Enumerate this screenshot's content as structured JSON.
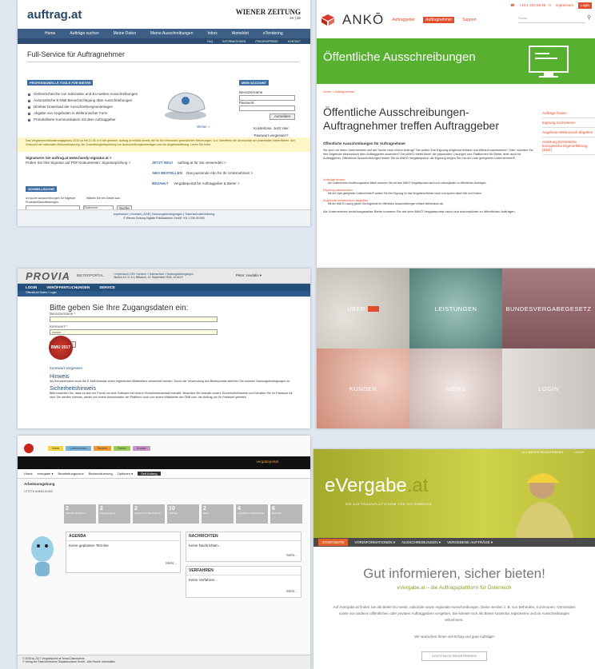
{
  "p1": {
    "logo": "auftrag.at",
    "brand": "WIENER ZEITUNG",
    "lang": "en | de",
    "nav": [
      "Home",
      "Aufträge suchen",
      "Meine Daten",
      "Meine Ausschreibungen",
      "Inbox",
      "Abmeldet",
      "eTendering"
    ],
    "subnav": [
      "FAQ",
      "INFORMATIONEN",
      "FRAGEN/PREISE",
      "KONTAKT"
    ],
    "title": "Full-Service für Auftragnehmer",
    "tools_heading": "PROFESSIONELLE TOOLS FÜR BIETER",
    "bullets": [
      "Onlinerecherche von nationalen und EU-weiten Ausschreibungen",
      "Automatische E-Mail Benachrichtigung über Ausschreibungen",
      "Direkter Download der Ausschreibungsunterlagen",
      "Abgabe von Angeboten in elektronischer Form",
      "Protokollierte Kommunikation mit dem Auftraggeber"
    ],
    "weiter": "Weiter »",
    "account_heading": "MEIN ACCOUNT",
    "username_label": "Benutzername",
    "password_label": "Passwort",
    "login_button": "Anmelden",
    "register_link": "Kostenlose. Jetzt Hier",
    "forgot_link": "Passwort vergessen?",
    "notice": "Das Vergaberechtsänderungsgesetz 2015 ist mit 21.08. in Kraft getreten. auftrag.at enthält bereits die für Sie relevanten gesetzlichen Neuerungen. U.a. betreffend die Anonymität der potentiellen Bieter/Bieter, den Zeitpunkt der nationalen Bekanntmachung, die Zuverlässigkeitsprüfung von Ausschreibungsunterlagen und die Angebotsöffnung. Lesen Sie mehr",
    "signaturen": "Signaturen Sie auftrag.at www.handy-signatur.at >",
    "signaturen_sub": "Prüfen Sie Ihre Signatur auf PDF-Dokumenten: Signaturprüfung >",
    "jetzt_neu": "JETZT NEU!",
    "jetzt_neu_text": "auftrag.at für Sie verwenden >",
    "abo": "ABO BESTELLEN",
    "abo_text": "Das passende Abo für Ihr Unternehmen >",
    "bezahlt": "BEZAHLT",
    "bezahlt_text": "Vergabeportal für Auftraggeber & Bieter >",
    "quick_heading": "SCHNELLSUCHE",
    "quick_label": "Ich suche Ausschreibungen für folgende Produkte/Dienstleistungen:",
    "quick_label2": "Wählen Sie ein Gebiet aus:",
    "region_value": "Österreich",
    "search_button": "Suche",
    "footer_links": "Impressum | Kontakt | AGB | Nutzungsbedingungen | Datenschutzerklärung",
    "footer_copy": "© Wiener Zeitung Digitale Publikationen GmbH +43 1 206 99-500"
  },
  "p2": {
    "phone": "+43 1 333 66 66 - 0",
    "impressum": "Impressum",
    "login": "Login",
    "logo": "ANKŌ",
    "nav": [
      "Auftraggeber",
      "Auftragnehmer",
      "Support"
    ],
    "search_placeholder": "Suche",
    "banner": "Öffentliche Ausschreibungen",
    "breadcrumb": "Home > Auftragnehmer",
    "h1": "Öffentliche Ausschreibungen-Auftragnehmer treffen Auftraggeber",
    "sub": "Öffentliche Ausschreibungen für Auftragnehmer",
    "para": "Sie sind mit Ihrem Unternehmen auf der Suche nach einem Auftrag? Sie wollen Ihre Eignung möglichst einfach und effizient nachweisen? Oder möchten Sie Ihre Angebote elektronisch dem Auftraggeber zusenden? Der ANKÖ bietet Ihnen die passenden Lösungen und Plattformen für Bieter, aber auch für Auftraggeber. Öffentliche Ausschreibungen finden Sie im ANKÖ Vergabeportal, die Eignung zeigen Sie mit der Liste geeigneter Unternehmen®.",
    "items": [
      {
        "title": "Aufträge finden",
        "text": "Als Unternehmen beziehungsweise Bieter kommen Sie mit dem ANKÖ Vergabeportal rasch und unkompliziert zu öffentlichen Aufträgen."
      },
      {
        "title": "Eignung nachweisen",
        "text": "Mit der Liste geeigneter Unternehmen® weisen Sie Ihre Eignung für das Vergabeverfahren rasch und sparen dabei Zeit und Kosten."
      },
      {
        "title": "Angebote elektronisch abgeben",
        "text": "Mit der ANKÖ Lösung geben Sie Angebote für öffentliche Ausschreibungen einfach elektronisch ab."
      }
    ],
    "closing": "Als Unternehmen beziehungsweise Bieter kommen Sie mit dem ANKÖ Vergabeportal rasch und unkompliziert zu öffentlichen Aufträgen.",
    "side": [
      "Aufträge finden",
      "Eignung nachweisen",
      "Angebote elektronisch abgeben",
      "Anleitung Einheitliche Europäische Eigenerklärung (EEE)"
    ]
  },
  "p3": {
    "logo": "PROVIA",
    "portal": "BIETERPORTAL",
    "links": "» Impressum  CSS: Hordorm  » Datenschutz  » Nutzungsbedingungen",
    "version": "Version 4.0.17.11 | Mittwoch, 12. September 2018, 13:44:07",
    "user": "Peter: neutalis ▾",
    "tabs": [
      "LOGIN",
      "VERÖFFENTLICHUNGEN",
      "SERVICE"
    ],
    "crumb": "Öffentliche Daten / Login",
    "heading": "Bitte geben Sie Ihre Zugangsdaten ein:",
    "user_label": "Benutzername *",
    "pass_label": "Kennwort *",
    "pass_value": "••••••••",
    "login_button": "Anmelden",
    "seal": "BMU 2017",
    "forgot": "Kennwort vergessen",
    "hint_heading": "Hinweis",
    "hint_text": "Als Benutzername muss die E-Mail Adresse eines registrierten Mitarbeiters verwendet werden. Durch die Verwendung des Bieterportals stimmen Sie unseren Nutzungsbedingungen zu.",
    "security_heading": "Sicherheitshinweis",
    "security_text": "Bitte beachten Sie, dass es sich bei Provia um eine Software mit hohem Sicherheitsstandard handelt. Beachten Sie deshalb unsere Sicherheitshinweise und behalten Sie Ihr Passwort für sich! Sie werden niemals, weder von einem Administrator der Plattform noch von einem Mitarbeiter der ÖBB usw. der Auftrag um Ihr Passwort gebeten."
  },
  "p4": {
    "tiles": [
      "ÜBER",
      "LEISTUNGEN",
      "BUNDESVERGABEGESETZ",
      "KUNDEN",
      "NEWS",
      "LOGIN"
    ],
    "colors": [
      "#c5c0b7",
      "#6f9e96",
      "#9b6f74",
      "#d9a89a",
      "#d9c9c6",
      "#d7d4d0"
    ]
  },
  "p5": {
    "tabs": [
      "Home",
      "Unternehmen",
      "Tenders",
      "Fakten",
      "Kontakt"
    ],
    "user": "vergabeportal",
    "menu": [
      "Home",
      "evergabe ▾",
      "Bearbeitungszone",
      "Bestrevaluierung",
      "Optionen ▾",
      "Seit Anfang"
    ],
    "section": "Arbeitsumgebung",
    "latest": "LETZTE ANMELDUNG",
    "stats": [
      "2",
      "2",
      "2",
      "10",
      "2",
      "4",
      "6"
    ],
    "stat_labels": [
      "Aktuelle Verfahren",
      "Eingegangene",
      "Angebote in Bearbeitung",
      "Aufträge",
      "Bieter",
      "Angebote in Bearbeitung",
      "Beendigt"
    ],
    "agenda": "AGENDA",
    "agenda_text": "Keine geplanten Termine",
    "more": "Mehr...",
    "messages": "NACHRICHTEN",
    "messages_text": "Keine Nachrichten...",
    "procedures": "VERFAHREN",
    "procedures_text": "Keine Verfahren...",
    "footer1": "© 2008 by 2017 Vergabeportal.at  Terms  Datenschutz",
    "footer2": "© Verlag der Österreichischen Staatsdruckerei GmbH - Alle Rechte vorbehalten"
  },
  "p6": {
    "top_links": [
      "ALS BIETER REGISTRIEREN",
      "LOGIN"
    ],
    "logo_main": "eVergabe",
    "logo_tld": ".at",
    "tagline": "DIE AUFTRAGSPLATTFORM FÜR ÖSTERREICH",
    "nav": [
      "STARTSEITE",
      "VORINFORMATIONEN ▾",
      "AUSSCHREIBUNGEN ▾",
      "VERGEBENE AUFTRÄGE ▾"
    ],
    "headline": "Gut informieren, sicher bieten!",
    "subline": "eVergabe.at – die Auftragsplattform für Österreich",
    "para": "Auf eVergabe.at finden Sie als Bieter EU-weite, nationale sowie regionale Ausschreibungen. Diese werden z. B. von Behörden, Kommunen, Gemeinden sowie von anderen öffentlichen oder privaten Auftraggebern vergeben. Sie können sich als Bieter kostenlos registrieren und an Ausschreibungen teilnehmen.",
    "wish": "Wir wünschen Ihnen viel Erfolg und gute Aufträge!",
    "button": "KOSTENLOS REGISTRIEREN"
  }
}
